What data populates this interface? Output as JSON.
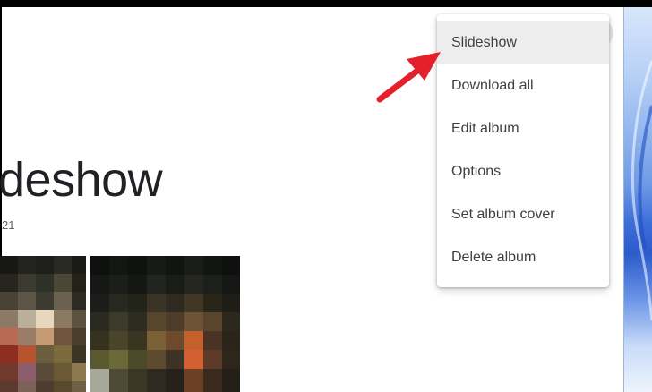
{
  "album": {
    "title": "deshow",
    "date": "21"
  },
  "menu": {
    "items": [
      {
        "label": "Slideshow"
      },
      {
        "label": "Download all"
      },
      {
        "label": "Edit album"
      },
      {
        "label": "Options"
      },
      {
        "label": "Set album cover"
      },
      {
        "label": "Delete album"
      }
    ]
  },
  "colors": {
    "annotation_arrow": "#e3202b",
    "menu_hover": "#ededed",
    "text_primary": "#202124"
  }
}
